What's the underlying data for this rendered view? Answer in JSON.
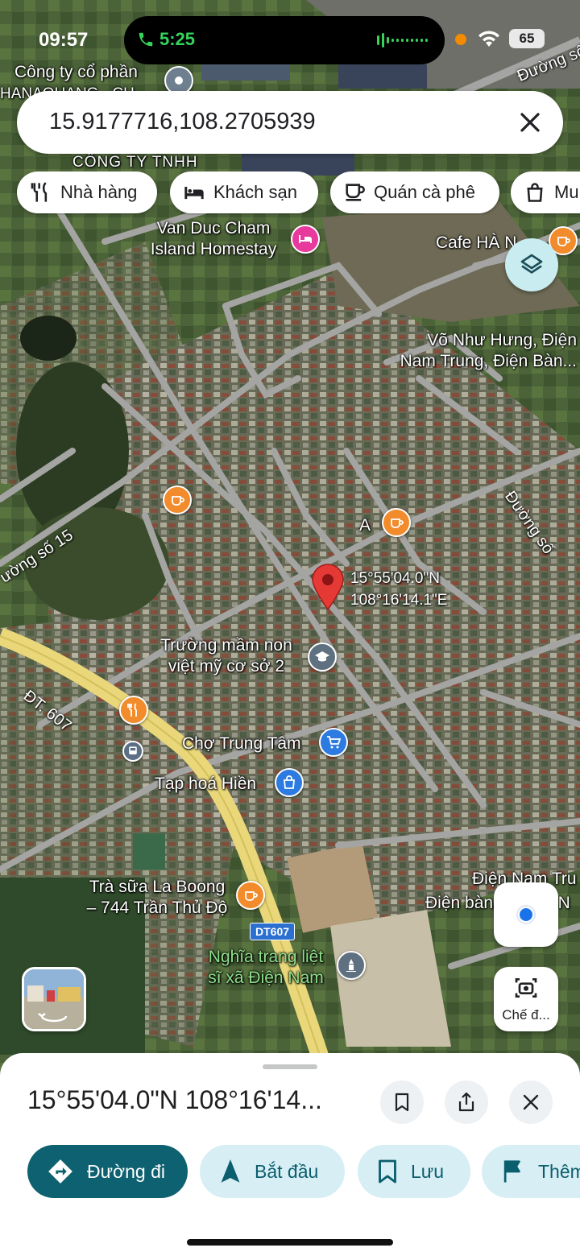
{
  "status_bar": {
    "time": "09:57",
    "call_time": "5:25",
    "battery": "65"
  },
  "search": {
    "query": "15.9177716,108.2705939"
  },
  "chips": [
    {
      "label": "Nhà hàng",
      "icon": "fork-knife-icon"
    },
    {
      "label": "Khách sạn",
      "icon": "bed-icon"
    },
    {
      "label": "Quán cà phê",
      "icon": "coffee-icon"
    },
    {
      "label": "Mu",
      "icon": "shopping-bag-icon"
    }
  ],
  "map": {
    "labels": {
      "cong_ty_co_phan": "Công ty cổ phần",
      "hanaquang": "HANAQUANG - CH...",
      "cong_ty_tnhh": "CÔNG TY TNHH",
      "van_duc_cham": "Van Duc Cham\nIsland Homestay",
      "cafe_ha": "Cafe HÀ N...",
      "vo_nhu_hung": "Võ Như Hưng, Điện\nNam Trung, Điện Bàn...",
      "duong_so_top": "Đường số",
      "duong_so_right": "Đường số",
      "duong_so_15": "ường số 15",
      "dt_607": "ĐT. 607",
      "a": "A",
      "truong_mam_non": "Trường mầm non\nviệt mỹ cơ sở 2",
      "cho_trung_tam": "Chợ Trung Tâm",
      "tap_hoa_hien": "Tạp hoá Hiền",
      "tra_sua": "Trà sữa La Boong\n– 744 Trần Thủ Độ",
      "dien_nam_tru": "Điện Nam Tru",
      "dien_ban": "Điện bàn, Quảng N",
      "nghia_trang": "Nghĩa trang liệt\nsĩ xã Điện Nam",
      "route_shield": "DT607"
    },
    "pin_coords": "15°55'04.0\"N\n108°16'14.1\"E"
  },
  "controls": {
    "camera_label": "Chế đ..."
  },
  "sheet": {
    "title": "15°55'04.0\"N 108°16'14...",
    "actions": [
      {
        "label": "Đường đi",
        "icon": "directions-icon"
      },
      {
        "label": "Bắt đầu",
        "icon": "navigation-arrow-icon"
      },
      {
        "label": "Lưu",
        "icon": "bookmark-icon"
      },
      {
        "label": "Thêm",
        "icon": "flag-icon"
      }
    ]
  },
  "colors": {
    "accent": "#0e6170",
    "pin": "#e53935",
    "poi_food": "#f28b2c",
    "poi_hotel": "#e8399c",
    "poi_shop": "#2d7be0"
  }
}
